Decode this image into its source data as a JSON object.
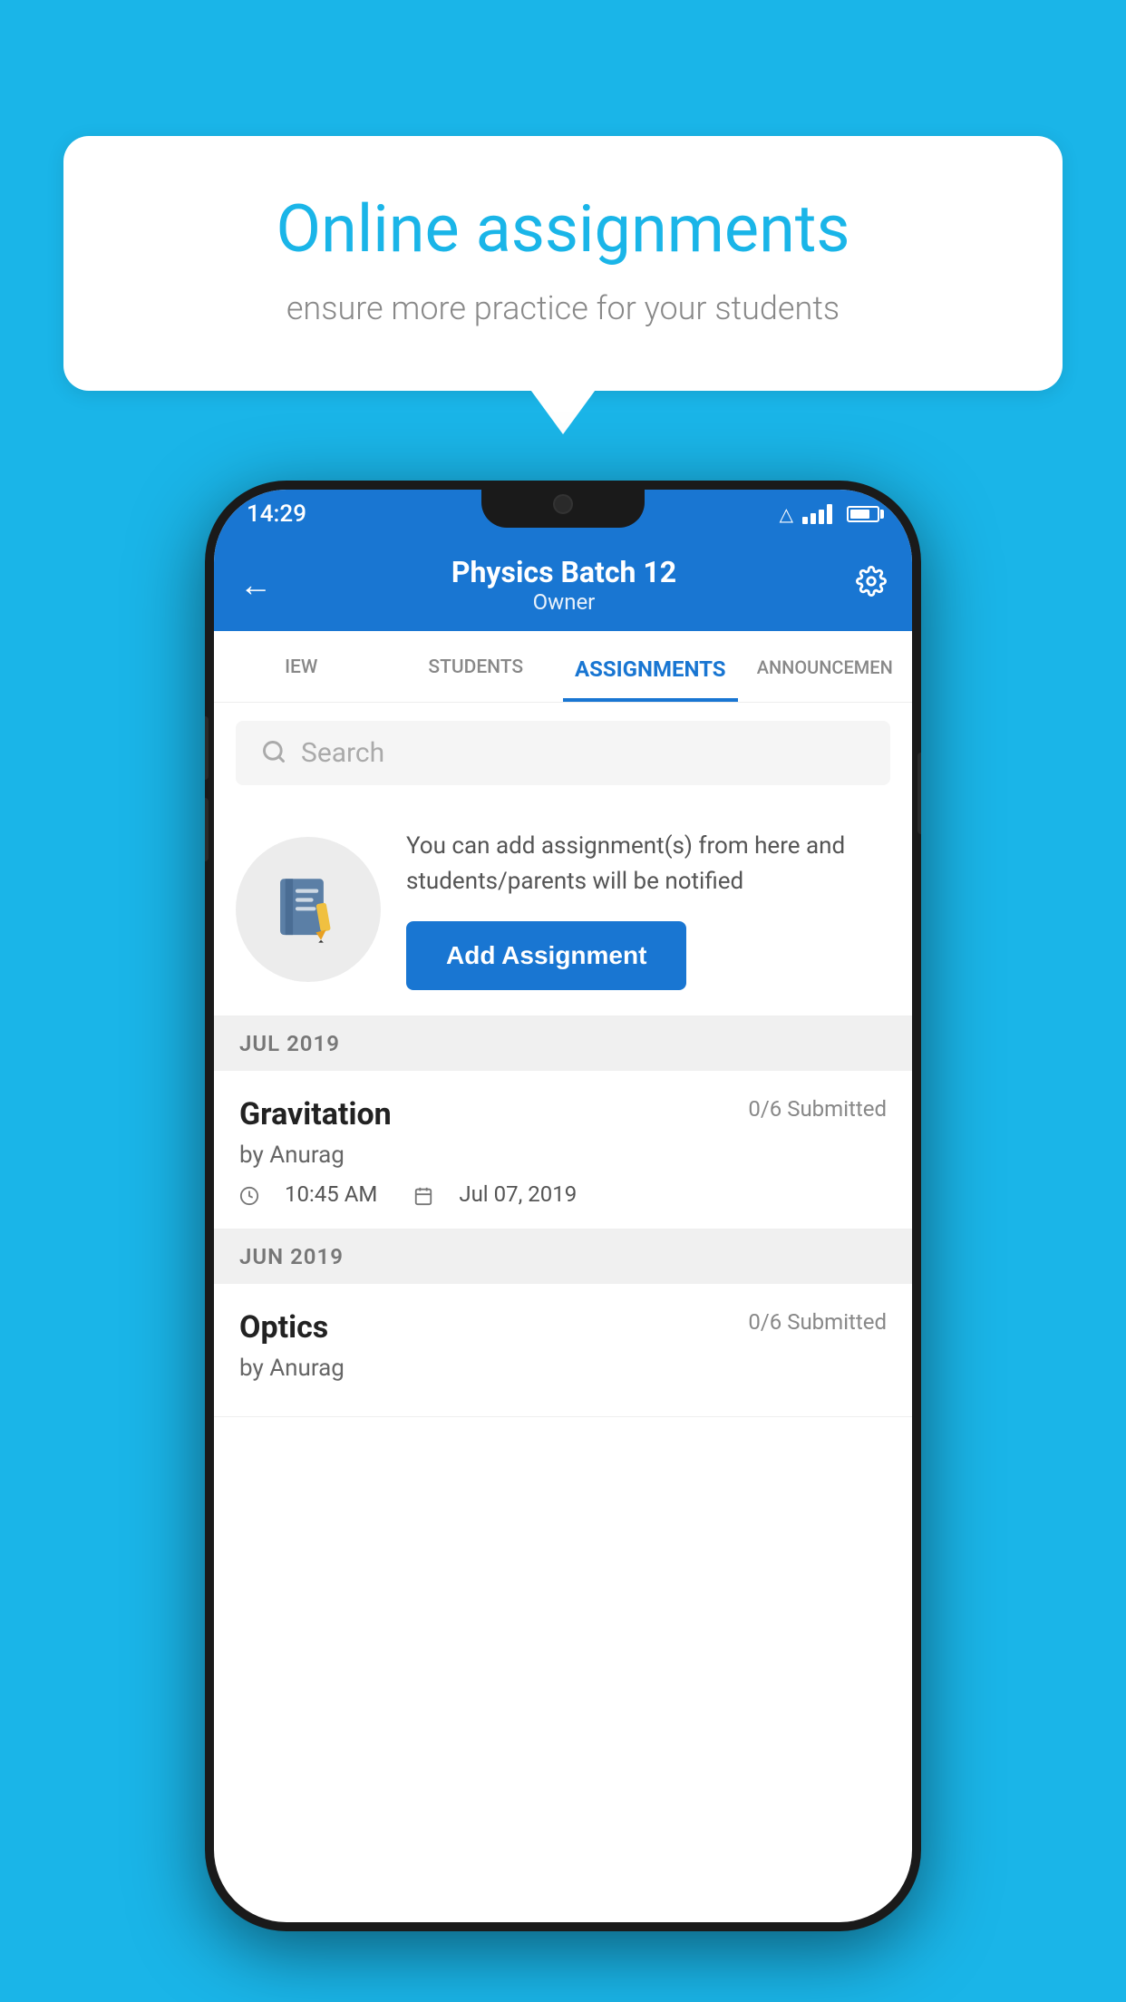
{
  "background_color": "#1ab5e8",
  "speech_bubble": {
    "title": "Online assignments",
    "subtitle": "ensure more practice for your students"
  },
  "phone": {
    "status_bar": {
      "time": "14:29"
    },
    "header": {
      "title": "Physics Batch 12",
      "subtitle": "Owner",
      "back_label": "←",
      "settings_label": "⚙"
    },
    "tabs": [
      {
        "label": "IEW",
        "active": false
      },
      {
        "label": "STUDENTS",
        "active": false
      },
      {
        "label": "ASSIGNMENTS",
        "active": true
      },
      {
        "label": "ANNOUNCEMENTS",
        "active": false
      }
    ],
    "search": {
      "placeholder": "Search"
    },
    "promo": {
      "description": "You can add assignment(s) from here and students/parents will be notified",
      "add_button_label": "Add Assignment"
    },
    "months": [
      {
        "label": "JUL 2019",
        "assignments": [
          {
            "name": "Gravitation",
            "submitted": "0/6 Submitted",
            "by": "by Anurag",
            "time": "10:45 AM",
            "date": "Jul 07, 2019"
          }
        ]
      },
      {
        "label": "JUN 2019",
        "assignments": [
          {
            "name": "Optics",
            "submitted": "0/6 Submitted",
            "by": "by Anurag",
            "time": "",
            "date": ""
          }
        ]
      }
    ]
  }
}
